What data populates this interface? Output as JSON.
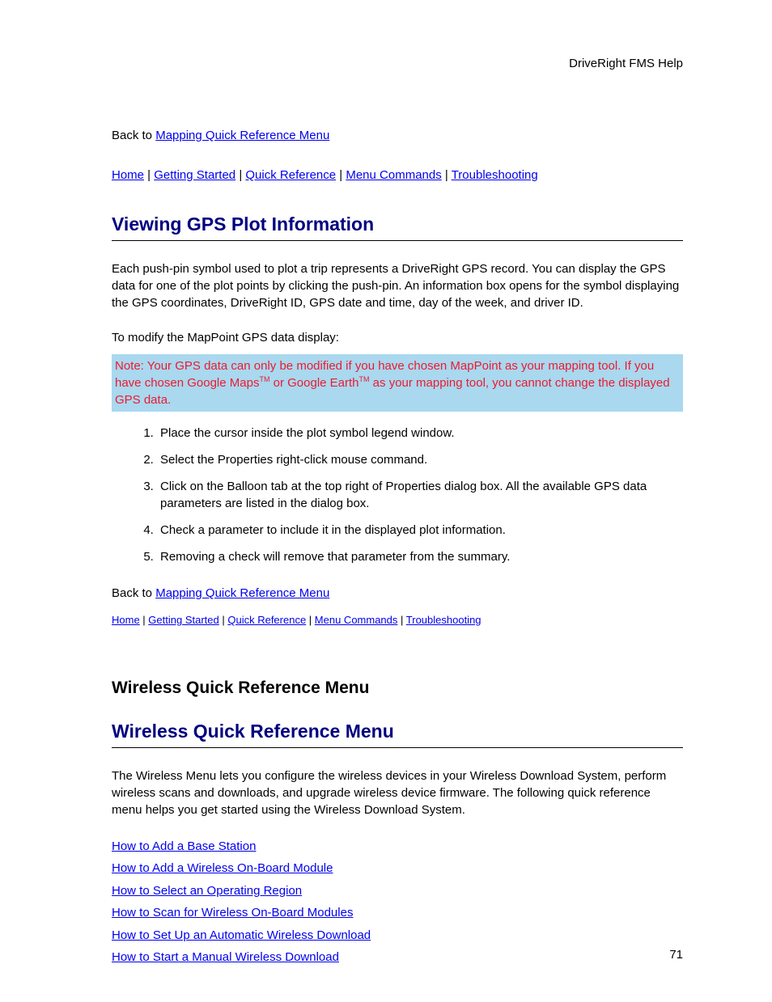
{
  "header": {
    "title": "DriveRight FMS Help"
  },
  "back1": {
    "prefix": "Back to ",
    "link": "Mapping Quick Reference Menu"
  },
  "nav": {
    "home": "Home",
    "getting_started": "Getting Started",
    "quick_reference": "Quick Reference",
    "menu_commands": "Menu Commands",
    "troubleshooting": "Troubleshooting",
    "sep": " | "
  },
  "section1": {
    "heading": "Viewing GPS Plot Information",
    "para1": "Each push-pin symbol used to plot a trip represents a DriveRight GPS record. You can display the GPS data for one of  the plot points by clicking the push-pin. An information box opens for the symbol displaying the GPS coordinates, DriveRight ID, GPS date and time, day of the week, and driver ID.",
    "para2": "To modify the MapPoint GPS data display:",
    "note_part1": "Note: Your GPS data can only be modified if you have chosen MapPoint as your mapping tool. If you have chosen Google Maps",
    "note_tm1": "TM",
    "note_part2": " or Google Earth",
    "note_tm2": "TM",
    "note_part3": " as your mapping tool, you cannot change the displayed GPS data.",
    "steps": [
      "Place the cursor inside the plot symbol legend window.",
      "Select the Properties right-click mouse command.",
      "Click on the Balloon tab at the top right of Properties dialog box. All the available GPS data parameters are listed in the dialog box.",
      "Check a parameter to include it in the displayed plot information.",
      "Removing a check will remove that parameter from the summary."
    ]
  },
  "back2": {
    "prefix": "Back to  ",
    "link": "Mapping Quick Reference Menu"
  },
  "section2": {
    "black_heading": "Wireless Quick Reference Menu",
    "blue_heading": "Wireless Quick Reference Menu",
    "para": "The Wireless Menu lets you configure the wireless devices in your Wireless Download System, perform wireless scans and downloads, and upgrade wireless device firmware. The following quick reference menu helps you get started using the Wireless Download System.",
    "links": [
      "How to Add a Base Station",
      "How to Add a Wireless On-Board Module",
      "How to Select an Operating Region",
      "How to Scan for Wireless On-Board Modules",
      "How to Set Up an Automatic Wireless Download",
      "How to Start a Manual Wireless Download"
    ]
  },
  "page_number": "71"
}
